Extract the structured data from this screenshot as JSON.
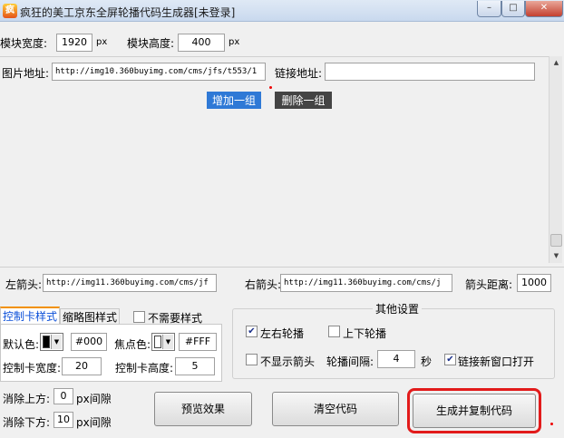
{
  "window": {
    "title": "疯狂的美工京东全屏轮播代码生成器[未登录]",
    "icon_label": "疯",
    "controls": {
      "minimize": "–",
      "maximize": "□",
      "close": "✕"
    }
  },
  "module": {
    "width_label": "模块宽度:",
    "width_value": "1920",
    "width_unit": "px",
    "height_label": "模块高度:",
    "height_value": "400",
    "height_unit": "px"
  },
  "image_row": {
    "image_label": "图片地址:",
    "image_value": "http://img10.360buyimg.com/cms/jfs/t553/1",
    "link_label": "链接地址:",
    "link_value": ""
  },
  "group_buttons": {
    "add": "增加一组",
    "delete": "删除一组"
  },
  "arrows": {
    "left_label": "左箭头:",
    "left_value": "http://img11.360buyimg.com/cms/jf",
    "right_label": "右箭头:",
    "right_value": "http://img11.360buyimg.com/cms/j",
    "distance_label": "箭头距离:",
    "distance_value": "1000"
  },
  "tabs": {
    "control": "控制卡样式",
    "thumbnail": "缩略图样式",
    "no_style": "不需要样式"
  },
  "control_card": {
    "default_color_label": "默认色:",
    "default_color_value": "#000",
    "default_color_hex": "#000000",
    "focus_color_label": "焦点色:",
    "focus_color_value": "#FFF",
    "focus_color_hex": "#FFFFFF",
    "width_label": "控制卡宽度:",
    "width_value": "20",
    "height_label": "控制卡高度:",
    "height_value": "5"
  },
  "other": {
    "title": "其他设置",
    "lr_carousel": "左右轮播",
    "lr_checked": true,
    "ud_carousel": "上下轮播",
    "ud_checked": false,
    "hide_arrows": "不显示箭头",
    "hide_checked": false,
    "interval_label": "轮播间隔:",
    "interval_value": "4",
    "interval_unit": "秒",
    "new_window": "链接新窗口打开",
    "new_window_checked": true
  },
  "gaps": {
    "top_label": "消除上方:",
    "top_value": "0",
    "top_unit": "px间隙",
    "bottom_label": "消除下方:",
    "bottom_value": "10",
    "bottom_unit": "px间隙"
  },
  "actions": {
    "preview": "预览效果",
    "clear": "清空代码",
    "generate": "生成并复制代码"
  },
  "colors": {
    "accent_blue": "#2f79d6",
    "tab_active": "#0b4fd8",
    "highlight_red": "#e21b1b"
  }
}
